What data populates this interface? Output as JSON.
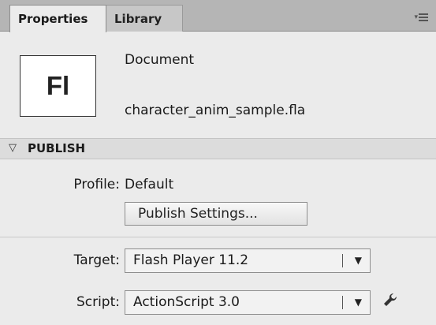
{
  "tabs": [
    {
      "label": "Properties",
      "active": true
    },
    {
      "label": "Library",
      "active": false
    }
  ],
  "panel_menu_icon": "panel-menu-icon",
  "document": {
    "logo_text": "Fl",
    "type_label": "Document",
    "filename": "character_anim_sample.fla"
  },
  "publish": {
    "section_title": "PUBLISH",
    "profile_label": "Profile:",
    "profile_value": "Default",
    "settings_button": "Publish Settings...",
    "target_label": "Target:",
    "target_value": "Flash Player 11.2",
    "script_label": "Script:",
    "script_value": "ActionScript 3.0",
    "script_settings_icon": "wrench-icon"
  }
}
